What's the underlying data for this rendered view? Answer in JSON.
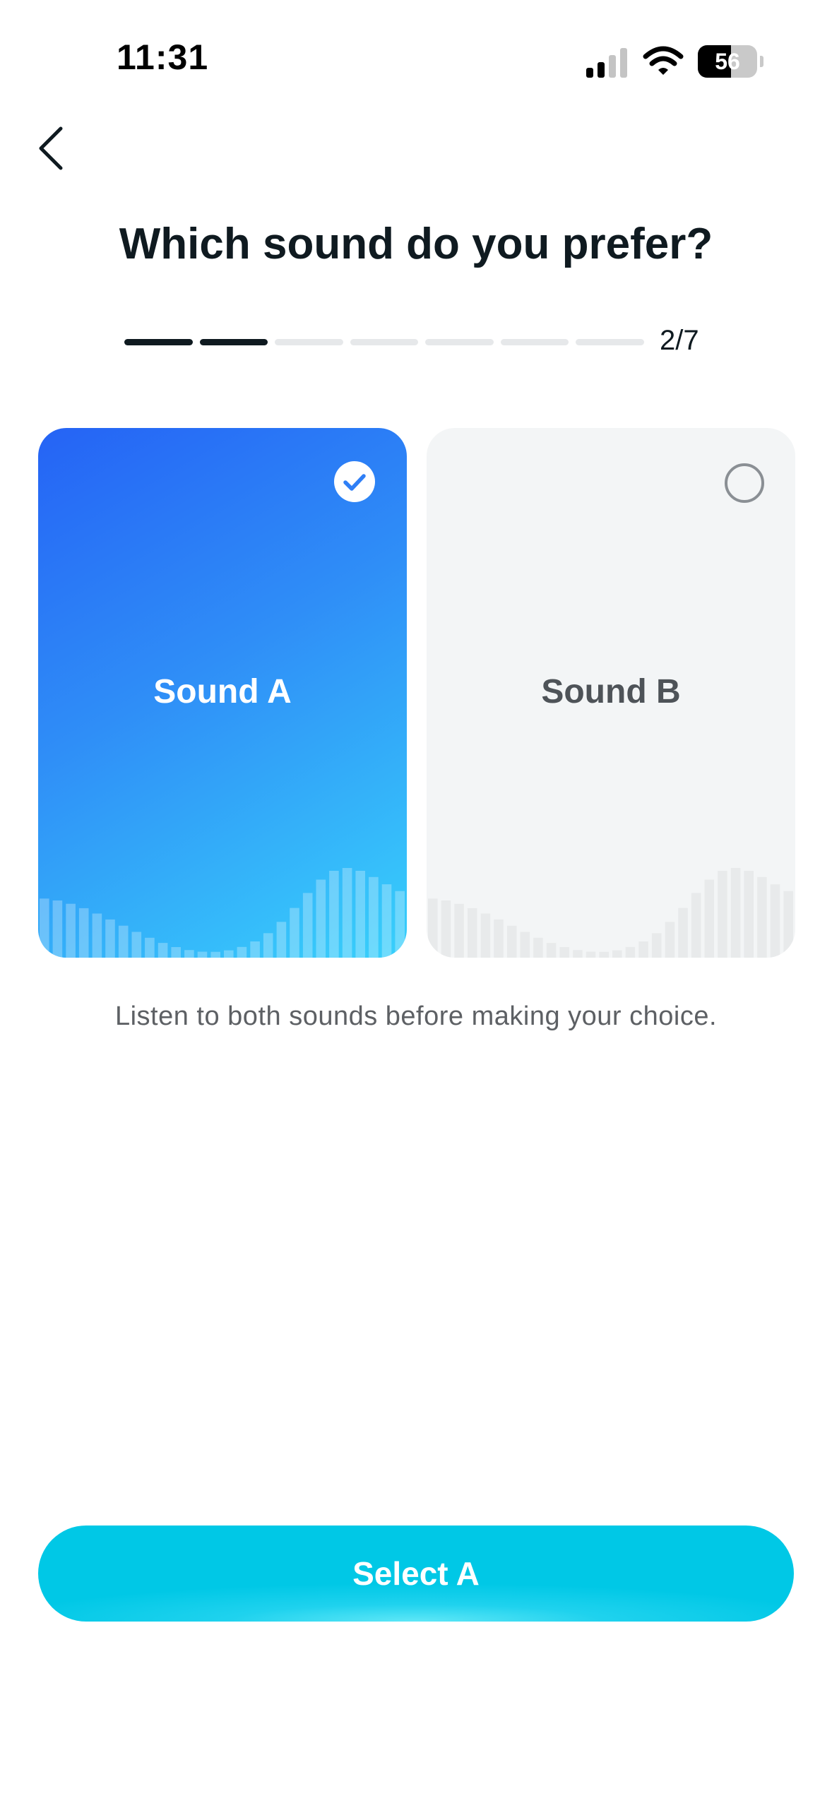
{
  "status_bar": {
    "time": "11:31",
    "battery": "56",
    "battery_level": 0.56
  },
  "header": {
    "back_icon": "chevron-left-icon",
    "title": "Which sound do you prefer?"
  },
  "progress": {
    "current": 2,
    "total": 7,
    "label": "2/7"
  },
  "options": [
    {
      "label": "Sound A",
      "selected": true,
      "icon": "check-circle-icon"
    },
    {
      "label": "Sound B",
      "selected": false,
      "icon": "radio-empty-icon"
    }
  ],
  "hint": "Listen to both sounds before making your choice.",
  "footer": {
    "button_label": "Select A"
  },
  "colors": {
    "accent": "#00c8e6",
    "selected_card_start": "#2563f5",
    "selected_card_end": "#38d0fb",
    "unselected_card": "#f3f5f6",
    "text": "#0f1a20"
  }
}
